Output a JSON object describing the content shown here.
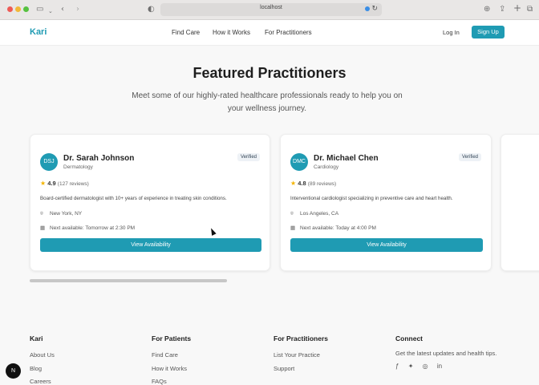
{
  "browser": {
    "url": "localhost"
  },
  "nav": {
    "logo": "Kari",
    "links": [
      "Find Care",
      "How it Works",
      "For Practitioners"
    ],
    "login": "Log In",
    "signup": "Sign Up"
  },
  "section": {
    "title": "Featured Practitioners",
    "subtitle": "Meet some of our highly-rated healthcare professionals ready to help you on your wellness journey."
  },
  "practitioners": [
    {
      "initials": "DSJ",
      "name": "Dr. Sarah Johnson",
      "specialty": "Dermatology",
      "badge": "Verified",
      "rating": "4.9",
      "reviews": "(127 reviews)",
      "bio": "Board-certified dermatologist with 10+ years of experience in treating skin conditions.",
      "location": "New York, NY",
      "availability": "Next available: Tomorrow at 2:30 PM",
      "button": "View Availability"
    },
    {
      "initials": "DMC",
      "name": "Dr. Michael Chen",
      "specialty": "Cardiology",
      "badge": "Verified",
      "rating": "4.8",
      "reviews": "(89 reviews)",
      "bio": "Interventional cardiologist specializing in preventive care and heart health.",
      "location": "Los Angeles, CA",
      "availability": "Next available: Today at 4:00 PM",
      "button": "View Availability"
    }
  ],
  "footer": {
    "brand": {
      "title": "Kari",
      "links": [
        "About Us",
        "Blog",
        "Careers"
      ]
    },
    "patients": {
      "title": "For Patients",
      "links": [
        "Find Care",
        "How it Works",
        "FAQs"
      ]
    },
    "practitioners": {
      "title": "For Practitioners",
      "links": [
        "List Your Practice",
        "Support"
      ]
    },
    "connect": {
      "title": "Connect",
      "text": "Get the latest updates and health tips.",
      "social": [
        "facebook-icon",
        "twitter-icon",
        "instagram-icon",
        "linkedin-icon"
      ]
    }
  },
  "dev_badge": "N",
  "colors": {
    "brand": "#1f9bb3"
  }
}
